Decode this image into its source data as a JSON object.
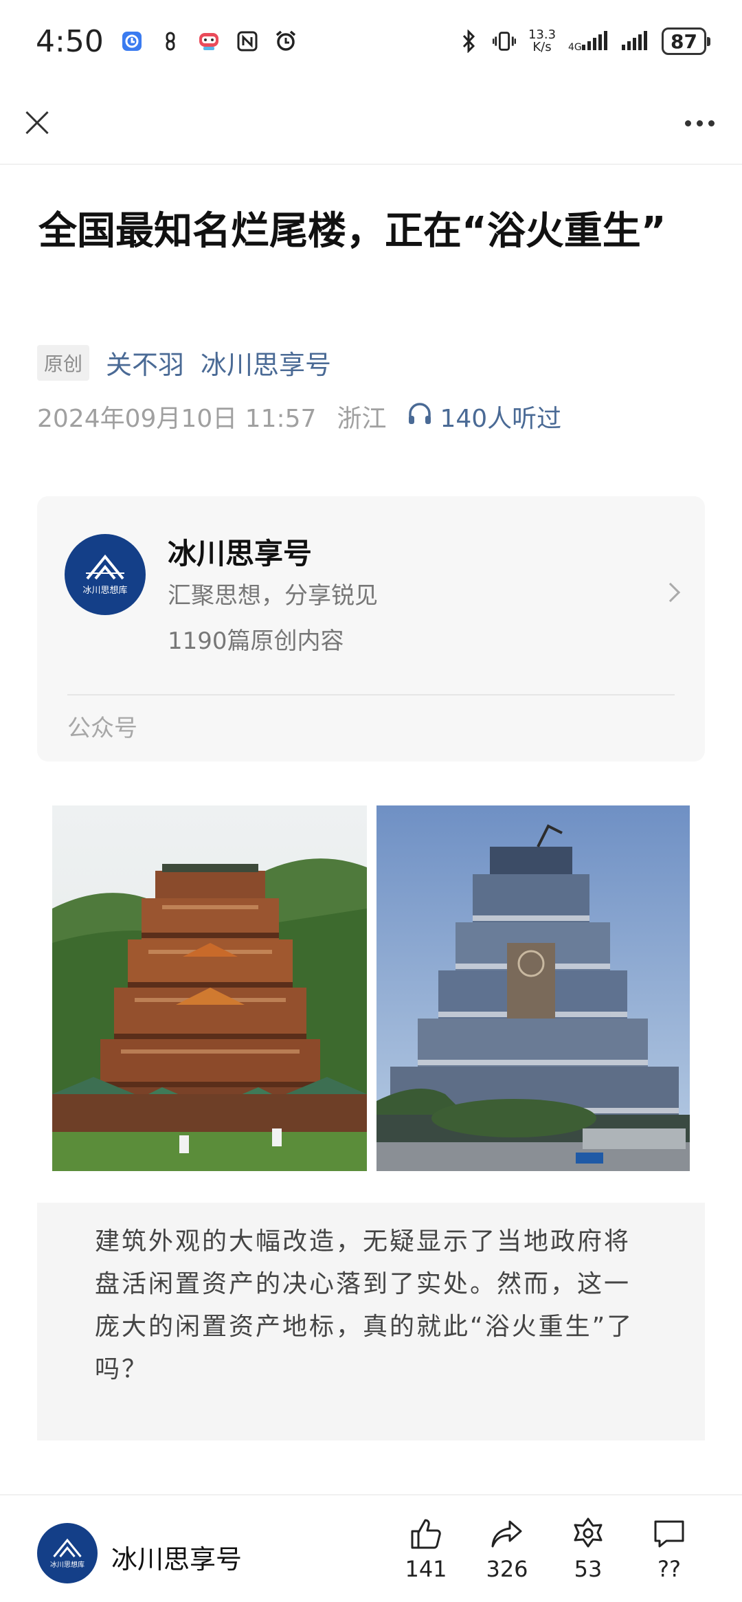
{
  "status_bar": {
    "time": "4:50",
    "net_speed_value": "13.3",
    "net_speed_unit": "K/s",
    "battery": "87"
  },
  "article": {
    "title": "全国最知名烂尾楼，正在“浴火重生”",
    "original_tag": "原创",
    "author": "关不羽",
    "account": "冰川思享号",
    "date": "2024年09月10日 11:57",
    "location": "浙江",
    "listeners": "140人听过"
  },
  "account_card": {
    "name": "冰川思享号",
    "slogan": "汇聚思想，分享锐见",
    "count": "1190篇原创内容",
    "type": "公众号",
    "logo_text": "冰川思想库"
  },
  "quote": {
    "text": "建筑外观的大幅改造，无疑显示了当地政府将盘活闲置资产的决心落到了实处。然而，这一庞大的闲置资产地标，真的就此“浴火重生”了吗？"
  },
  "bottom_bar": {
    "account": "冰川思享号",
    "like_count": "141",
    "share_count": "326",
    "favorite_count": "53",
    "comment_count": "??"
  },
  "colors": {
    "accent": "#4a6a95",
    "logo_bg": "#143f88"
  }
}
